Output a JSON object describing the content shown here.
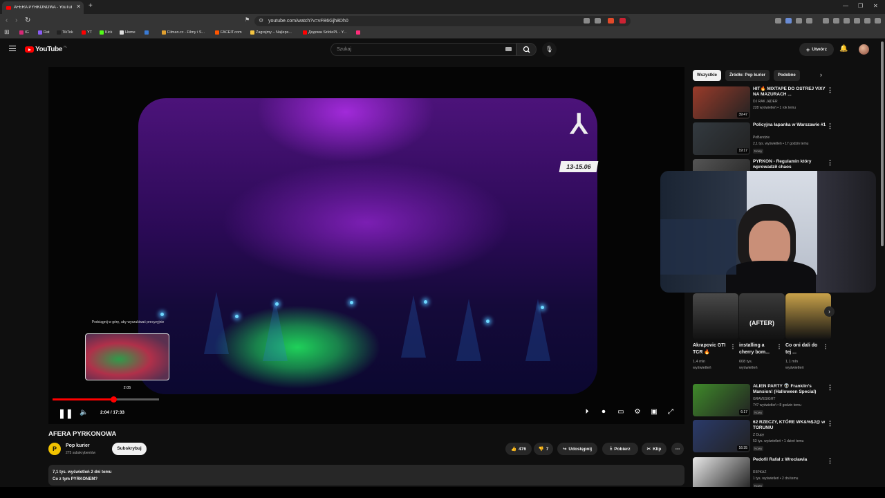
{
  "browser": {
    "tab_title": "AFERA PYRKONOWA - YouTube",
    "url": "youtube.com/watch?v=vFB6Gjh8Dh0",
    "bookmarks": [
      {
        "label": "IG",
        "color": "#d62976"
      },
      {
        "label": "Rat",
        "color": "#8a5cf5"
      },
      {
        "label": "TikTok",
        "color": "#222222"
      },
      {
        "label": "YT",
        "color": "#ff0000"
      },
      {
        "label": "Kick",
        "color": "#53fc18"
      },
      {
        "label": "Home",
        "color": "#dddddd"
      },
      {
        "label": "",
        "color": "#3a7bd5"
      },
      {
        "label": "Filman.cc - Filmy i S...",
        "color": "#e0a030"
      },
      {
        "label": "FACEIT.com",
        "color": "#ff5500"
      },
      {
        "label": "Zagrajmy – Najleps...",
        "color": "#f5c542"
      },
      {
        "label": "Додома SzlolePL - Y...",
        "color": "#ff0000"
      },
      {
        "label": "",
        "color": "#ff2d7a"
      }
    ]
  },
  "youtube": {
    "logo_text": "YouTube",
    "logo_region": "PL",
    "search_placeholder": "Szukaj",
    "create_label": "Utwórz"
  },
  "player": {
    "scrub_hint": "Podciągnij w górę, aby wyszukiwać precyzyjnie",
    "preview_time": "2:05",
    "time_display": "2:04 / 17:33",
    "progress_fraction": 0.118,
    "buffered_fraction": 0.148,
    "date_badge": "13-15.06"
  },
  "video": {
    "title": "AFERA PYRKONOWA",
    "channel": "Pop kurier",
    "channel_initial": "P",
    "subscribers": "275 subskrybentów",
    "subscribe_label": "Subskrybuj",
    "likes": "476",
    "dislikes": "7",
    "share_label": "Udostępnij",
    "download_label": "Pobierz",
    "clip_label": "Klip",
    "desc_stats": "7,1 tys. wyświetleń  2 dni temu",
    "desc_text": "Co z tym PYRKONEM?"
  },
  "sidebar": {
    "chips": [
      "Wszystkie",
      "Źródło: Pop kurier",
      "Podobne"
    ],
    "recs": [
      {
        "title": "HIT🔥 MIXTAPE DO OSTREJ VIXY NA MAZURACH ...",
        "channel": "DJ RAK JĄDER",
        "meta": "228 wyświetleń • 1 rok temu",
        "duration": "39:47",
        "new": "",
        "thumb": "#9a3b2a"
      },
      {
        "title": "Policyjna łapanka w Warszawie #1",
        "channel": "PoBandzie",
        "meta": "2,1 tys. wyświetleń • 17 godzin temu",
        "duration": "19:17",
        "new": "Nowy",
        "thumb": "#333a40"
      },
      {
        "title": "PYRKON - Regulamin który wprowadził chaos",
        "channel": "",
        "meta": "",
        "duration": "",
        "new": "",
        "thumb": "#555555"
      },
      {
        "title": "ALIEN PARTY 👽 Franklin's Mansion! (Halloween Special)",
        "channel": "GRAVESIGHT",
        "meta": "747 wyświetleń • 8 godzin temu",
        "duration": "6:17",
        "new": "Nowy",
        "thumb": "#3f8a2a"
      },
      {
        "title": "62 RZECZY, KTÓRE WK&%$J@ w TORUNIU",
        "channel": "Z Dupy",
        "meta": "53 tys. wyświetleń • 1 dzień temu",
        "duration": "16:35",
        "new": "Nowy",
        "thumb": "#2a3a6a"
      },
      {
        "title": "Pedofil Rafał z Wrocławia",
        "channel": "R3PKAZ",
        "meta": "1 tys. wyświetleń • 2 dni temu",
        "duration": "",
        "new": "Nowy",
        "thumb": "#e8e8e8"
      }
    ],
    "shorts": [
      {
        "title": "Akrapovic GTI TCR 🔥",
        "views": "1,4 mln wyświetleń",
        "thumb": "#4a4a4a"
      },
      {
        "title": "installing a cherry bom...",
        "views": "608 tys. wyświetleń",
        "overlay": "(AFTER)",
        "thumb": "#3a3a3a"
      },
      {
        "title": "Co oni dali do tej ...",
        "views": "1,1 mln wyświetleń",
        "thumb": "#c9a24a"
      }
    ]
  }
}
